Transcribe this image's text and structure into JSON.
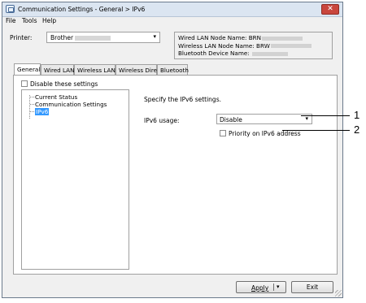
{
  "window": {
    "title": "Communication Settings - General > IPv6",
    "close_glyph": "✕"
  },
  "menu": [
    "File",
    "Tools",
    "Help"
  ],
  "printer": {
    "label": "Printer:",
    "value": "Brother"
  },
  "node_info": {
    "wired_label": "Wired LAN Node Name: BRN",
    "wireless_label": "Wireless LAN Node Name: BRW",
    "bluetooth_label": "Bluetooth Device Name:"
  },
  "tabs": [
    "General",
    "Wired LAN",
    "Wireless LAN",
    "Wireless Direct",
    "Bluetooth"
  ],
  "active_tab": "General",
  "disable_settings": {
    "label": "Disable these settings",
    "checked": false
  },
  "tree": {
    "items": [
      "Current Status",
      "Communication Settings",
      "IPv6"
    ],
    "selected": "IPv6"
  },
  "content": {
    "description": "Specify the IPv6 settings.",
    "usage_label": "IPv6 usage:",
    "usage_value": "Disable",
    "priority_label": "Priority on IPv6 address",
    "priority_checked": false
  },
  "buttons": {
    "apply": "Apply",
    "exit": "Exit"
  },
  "callouts": [
    "1",
    "2"
  ],
  "colors": {
    "selection": "#3399ff",
    "close_button": "#c9463d",
    "titlebar": "#dbe5f1"
  }
}
